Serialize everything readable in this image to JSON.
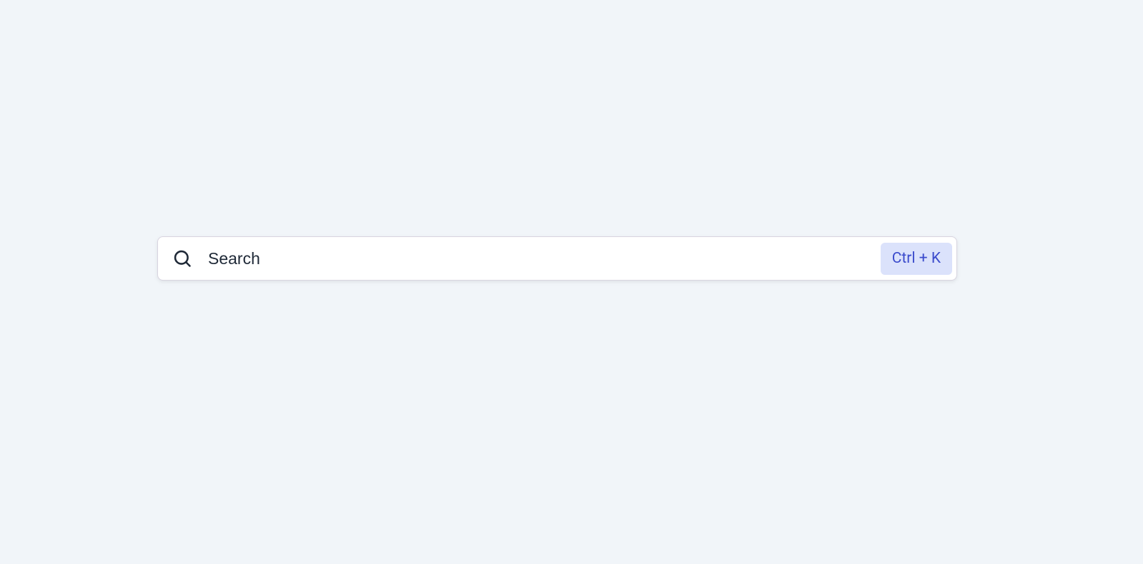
{
  "search": {
    "placeholder": "Search",
    "value": "",
    "shortcut_label": "Ctrl + K"
  }
}
